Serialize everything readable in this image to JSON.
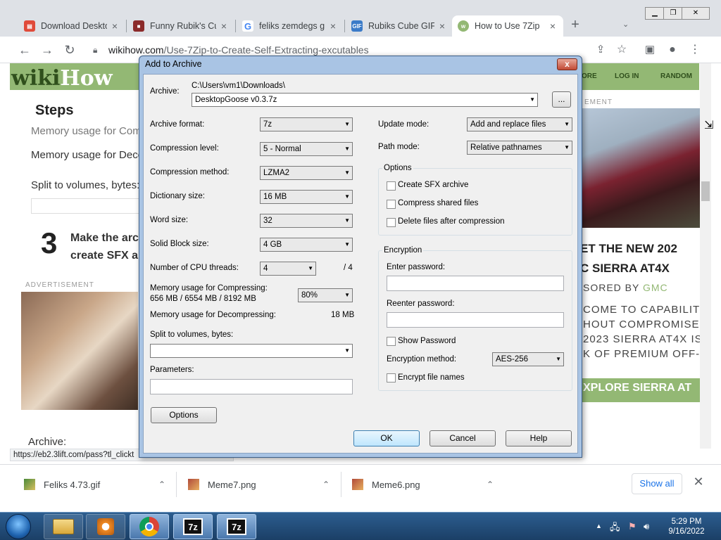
{
  "browser": {
    "tabs": [
      {
        "title": "Download Deskto",
        "icon": "calendar-icon"
      },
      {
        "title": "Funny Rubik's Cu",
        "icon": "cube-icon"
      },
      {
        "title": "feliks zemdegs g",
        "icon": "google-icon"
      },
      {
        "title": "Rubiks Cube GIF",
        "icon": "gif-icon"
      },
      {
        "title": "How to Use 7Zip",
        "icon": "wikihow-icon"
      }
    ],
    "new_tab": "+",
    "url_host": "wikihow.com",
    "url_path": "/Use-7Zip-to-Create-Self-Extracting-excutables",
    "status_url": "https://eb2.3lift.com/pass?tl_clickt"
  },
  "page": {
    "logo_wiki": "wiki",
    "logo_how": "How",
    "nav": [
      "ORE",
      "LOG IN",
      "RANDOM"
    ],
    "steps_heading": "Steps",
    "lines": [
      "Memory usage for Comp",
      "Memory usage for Deco",
      "Split to volumes, bytes:"
    ],
    "step_number": "3",
    "step_text_1": "Make the arc",
    "step_text_2": "create SFX a",
    "ad_label_left": "ADVERTISEMENT",
    "ad_label_right": "EMENT",
    "ad_line1": "ET THE NEW 202",
    "ad_line2": "C SIERRA AT4X",
    "ad_sponsor_prefix": "SORED BY ",
    "ad_sponsor_brand": "GMC",
    "ad_body": [
      "COME TO CAPABILITY",
      "HOUT COMPROMISE.",
      "2023 SIERRA AT4X IS",
      "K OF PREMIUM OFF-."
    ],
    "ad_cta": "XPLORE SIERRA AT",
    "archive_label": "Archive:"
  },
  "dialog": {
    "title": "Add to Archive",
    "archive_label": "Archive:",
    "archive_path": "C:\\Users\\vm1\\Downloads\\",
    "archive_name": "DesktopGoose v0.3.7z",
    "browse": "...",
    "archive_format_label": "Archive format:",
    "archive_format": "7z",
    "compression_level_label": "Compression level:",
    "compression_level": "5 - Normal",
    "compression_method_label": "Compression method:",
    "compression_method": "LZMA2",
    "dictionary_size_label": "Dictionary size:",
    "dictionary_size": "16 MB",
    "word_size_label": "Word size:",
    "word_size": "32",
    "solid_block_label": "Solid Block size:",
    "solid_block": "4 GB",
    "cpu_threads_label": "Number of CPU threads:",
    "cpu_threads": "4",
    "cpu_threads_max": "/ 4",
    "mem_compress_label": "Memory usage for Compressing:",
    "mem_compress_value": "656 MB / 6554 MB / 8192 MB",
    "mem_percent": "80%",
    "mem_decompress_label": "Memory usage for Decompressing:",
    "mem_decompress_value": "18 MB",
    "split_label": "Split to volumes, bytes:",
    "parameters_label": "Parameters:",
    "options_button": "Options",
    "update_mode_label": "Update mode:",
    "update_mode": "Add and replace files",
    "path_mode_label": "Path mode:",
    "path_mode": "Relative pathnames",
    "options_group": "Options",
    "create_sfx": "Create SFX archive",
    "compress_shared": "Compress shared files",
    "delete_after": "Delete files after compression",
    "encryption_group": "Encryption",
    "enter_password_label": "Enter password:",
    "reenter_password_label": "Reenter password:",
    "show_password": "Show Password",
    "encryption_method_label": "Encryption method:",
    "encryption_method": "AES-256",
    "encrypt_names": "Encrypt file names",
    "ok": "OK",
    "cancel": "Cancel",
    "help": "Help"
  },
  "downloads": {
    "items": [
      {
        "name": "Feliks 4.73.gif",
        "icon": "gif-file-icon"
      },
      {
        "name": "Meme7.png",
        "icon": "png-file-icon"
      },
      {
        "name": "Meme6.png",
        "icon": "png-file-icon"
      }
    ],
    "show_all": "Show all"
  },
  "taskbar": {
    "time": "5:29 PM",
    "date": "9/16/2022",
    "seven_zip_label": "7z"
  },
  "colors": {
    "wikihow_green": "#93b874",
    "chrome_tabbar": "#dee1e6",
    "dialog_frame": "#a9c4e4",
    "link_blue": "#1a73e8"
  }
}
